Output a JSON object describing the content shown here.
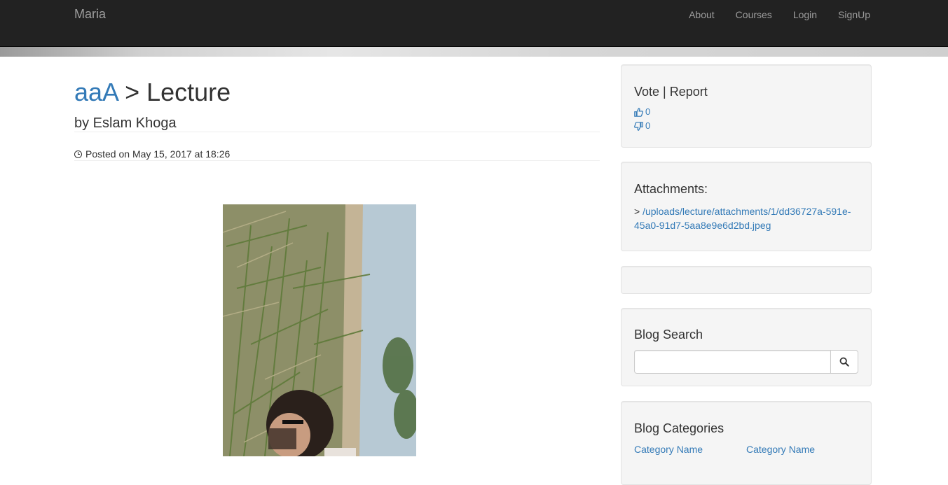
{
  "navbar": {
    "brand": "Maria",
    "links": [
      "About",
      "Courses",
      "Login",
      "SignUp"
    ]
  },
  "lecture": {
    "course_link": "aaA",
    "title_suffix": " > Lecture",
    "author": "by Eslam Khoga",
    "posted": "Posted on May 15, 2017 at 18:26"
  },
  "sidebar": {
    "vote": {
      "heading": "Vote | Report",
      "likes": "0",
      "dislikes": "0"
    },
    "attachments": {
      "heading": "Attachments:",
      "prefix": ">",
      "link": "/uploads/lecture/attachments/1/dd36727a-591e-45a0-91d7-5aa8e9e6d2bd.jpeg"
    },
    "search": {
      "heading": "Blog Search",
      "placeholder": ""
    },
    "categories": {
      "heading": "Blog Categories",
      "items": [
        "Category Name",
        "Category Name"
      ]
    }
  },
  "colors": {
    "navbar": "#222222",
    "link": "#337ab7",
    "well": "#f5f5f5"
  }
}
